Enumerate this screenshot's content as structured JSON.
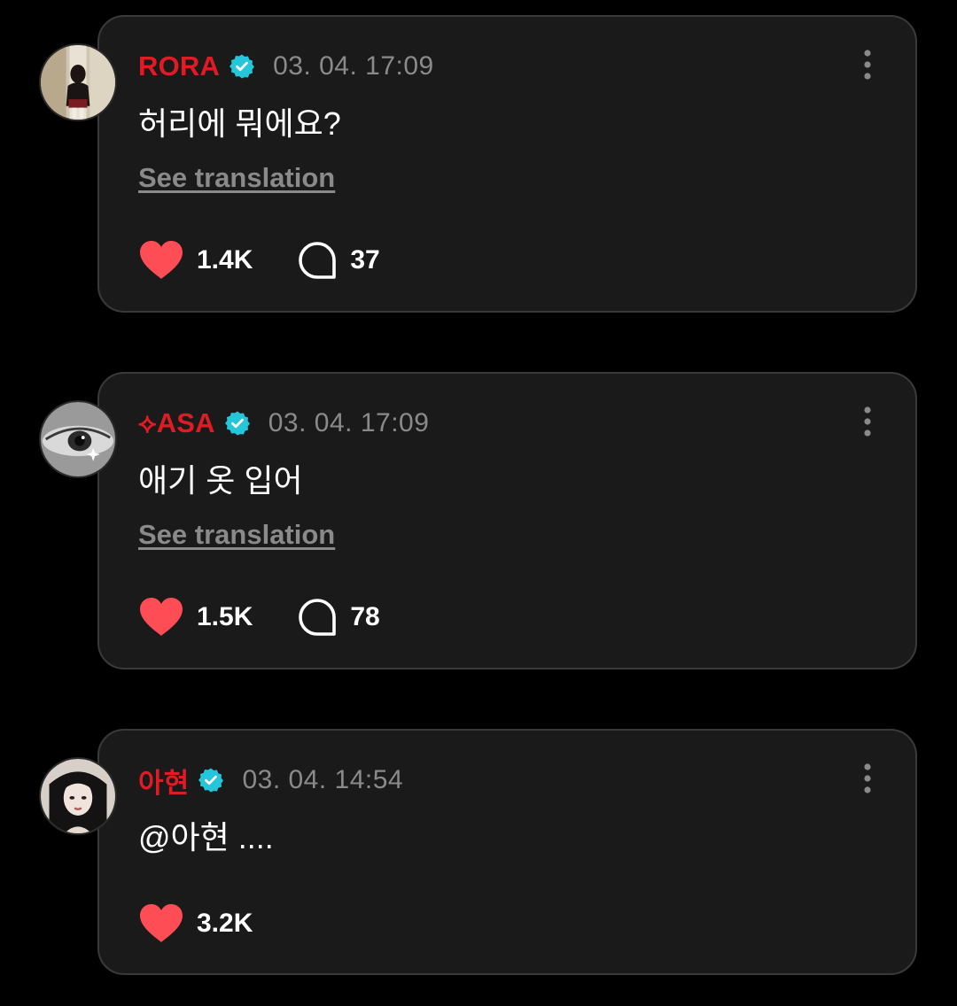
{
  "colors": {
    "background": "#000000",
    "card": "#1a1a1a",
    "card_border": "#3a3a3a",
    "username": "#e01b24",
    "verified_badge": "#26c6da",
    "heart": "#ff4d55",
    "muted_text": "#8a8a8a",
    "text": "#ffffff"
  },
  "comments": [
    {
      "username": "RORA",
      "verified": true,
      "timestamp": "03. 04. 17:09",
      "text": "허리에 뭐에요?",
      "translate_label": "See translation",
      "likes": "1.4K",
      "replies": "37",
      "icons": [
        "avatar",
        "verified-badge-icon",
        "more-options-icon",
        "heart-icon",
        "reply-bubble-icon"
      ]
    },
    {
      "username": "⟡ASA",
      "verified": true,
      "timestamp": "03. 04. 17:09",
      "text": "애기 옷 입어",
      "translate_label": "See translation",
      "likes": "1.5K",
      "replies": "78",
      "icons": [
        "avatar",
        "verified-badge-icon",
        "more-options-icon",
        "heart-icon",
        "reply-bubble-icon"
      ]
    },
    {
      "username": "아현",
      "verified": true,
      "timestamp": "03. 04. 14:54",
      "text": "@아현 ....",
      "likes": "3.2K",
      "icons": [
        "avatar",
        "verified-badge-icon",
        "more-options-icon",
        "heart-icon"
      ]
    }
  ]
}
